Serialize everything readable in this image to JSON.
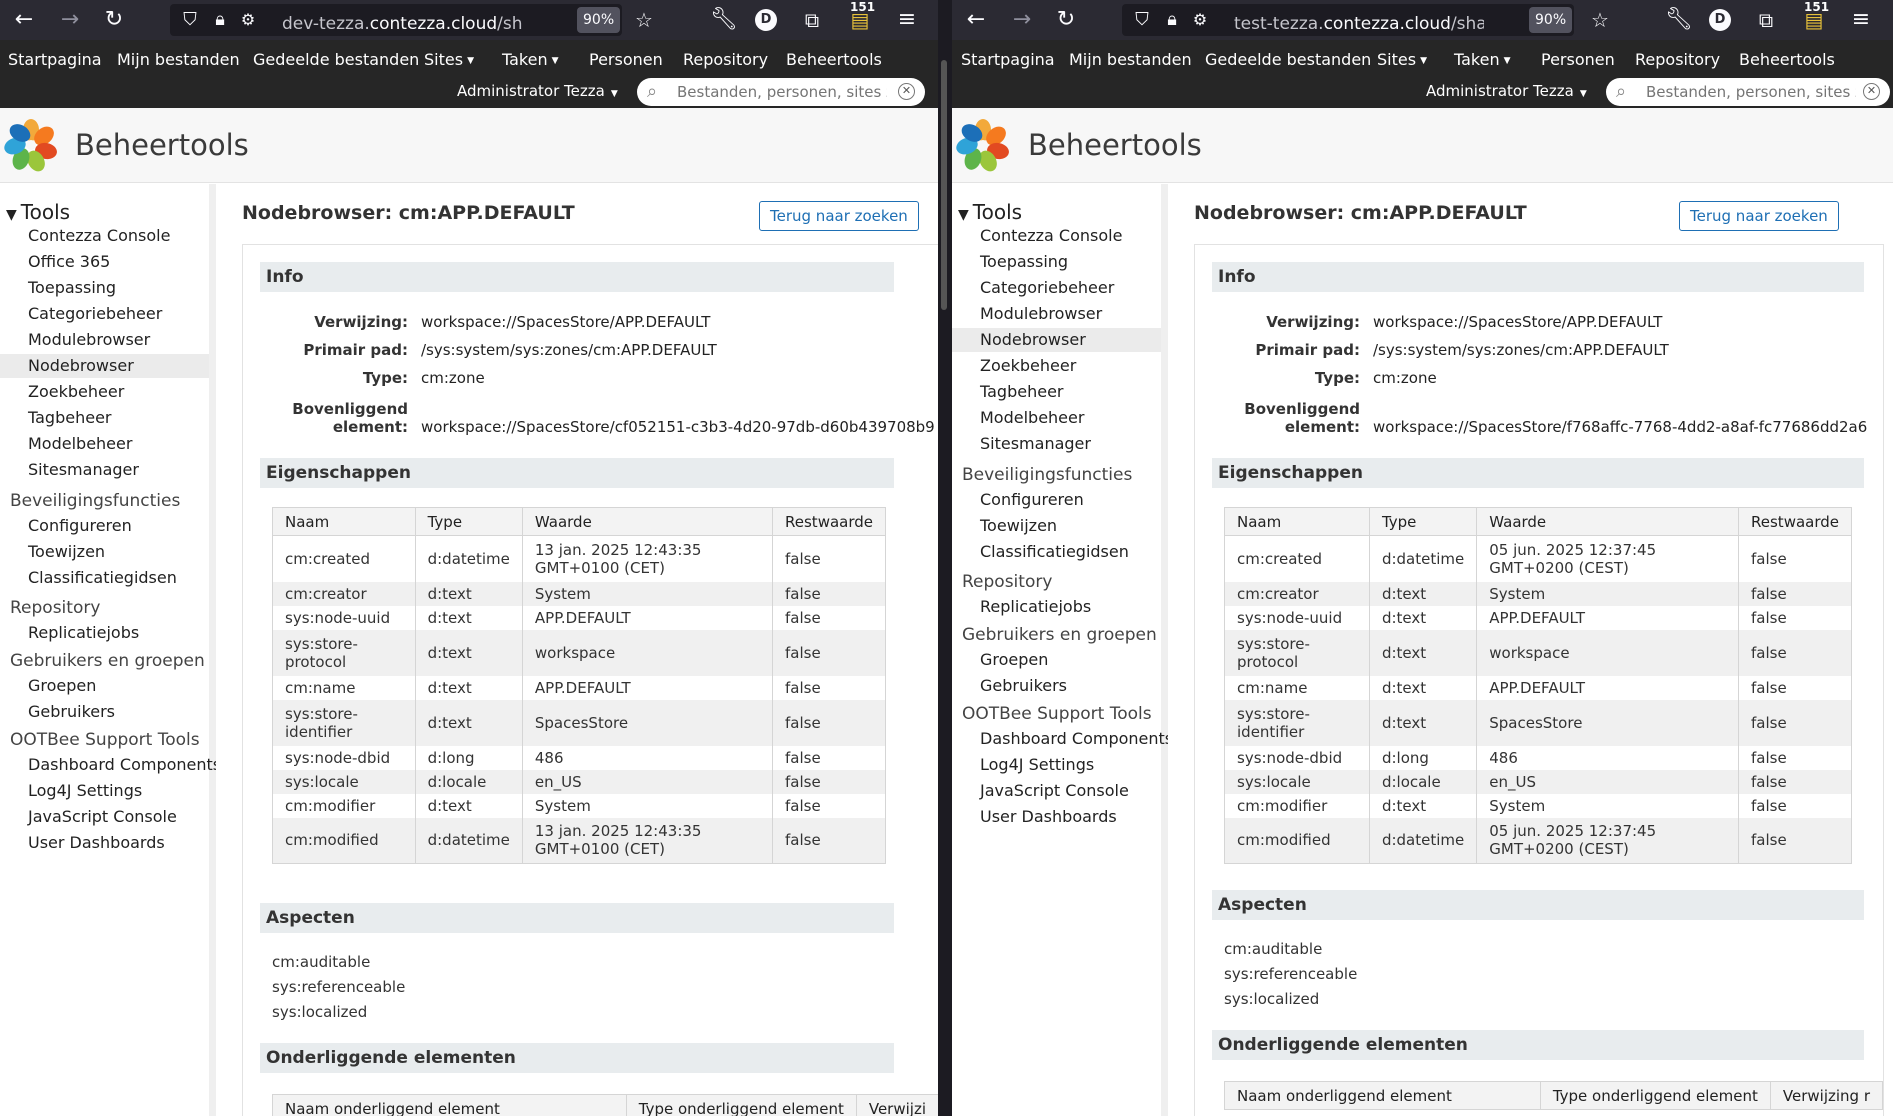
{
  "left": {
    "browser": {
      "url_prefix": "dev-tezza.",
      "url_domain": "contezza.cloud",
      "url_suffix": "/share/page",
      "zoom": "90%",
      "badge": "151",
      "profile": "D"
    },
    "nav": {
      "items": [
        "Startpagina",
        "Mijn bestanden",
        "Gedeelde bestanden",
        "Sites",
        "Taken",
        "Personen",
        "Repository",
        "Beheertools"
      ],
      "user": "Administrator Tezza",
      "search_placeholder": "Bestanden, personen, sites zo"
    },
    "page_title": "Beheertools",
    "sidebar": {
      "tools_heading": "Tools",
      "tools_items": [
        "Contezza Console",
        "Office 365",
        "Toepassing",
        "Categoriebeheer",
        "Modulebrowser",
        "Nodebrowser",
        "Zoekbeheer",
        "Tagbeheer",
        "Modelbeheer",
        "Sitesmanager"
      ],
      "groups": [
        {
          "name": "Beveiligingsfuncties",
          "items": [
            "Configureren",
            "Toewijzen",
            "Classificatiegidsen"
          ]
        },
        {
          "name": "Repository",
          "items": [
            "Replicatiejobs"
          ]
        },
        {
          "name": "Gebruikers en groepen",
          "items": [
            "Groepen",
            "Gebruikers"
          ]
        },
        {
          "name": "OOTBee Support Tools",
          "items": [
            "Dashboard Components",
            "Log4J Settings",
            "JavaScript Console",
            "User Dashboards"
          ]
        }
      ]
    },
    "main": {
      "heading": "Nodebrowser: cm:APP.DEFAULT",
      "back_button": "Terug naar zoeken",
      "info_title": "Info",
      "info": {
        "ref_label": "Verwijzing:",
        "ref": "workspace://SpacesStore/APP.DEFAULT",
        "path_label": "Primair pad:",
        "path": "/sys:system/sys:zones/cm:APP.DEFAULT",
        "type_label": "Type:",
        "type": "cm:zone",
        "parent_label_1": "Bovenliggend",
        "parent_label_2": "element:",
        "parent": "workspace://SpacesStore/cf052151-c3b3-4d20-97db-d60b439708b9"
      },
      "props_title": "Eigenschappen",
      "props_headers": [
        "Naam",
        "Type",
        "Waarde",
        "Restwaarde"
      ],
      "props": [
        [
          "cm:created",
          "d:datetime",
          "13 jan. 2025 12:43:35 GMT+0100 (CET)",
          "false"
        ],
        [
          "cm:creator",
          "d:text",
          "System",
          "false"
        ],
        [
          "sys:node-uuid",
          "d:text",
          "APP.DEFAULT",
          "false"
        ],
        [
          "sys:store-protocol",
          "d:text",
          "workspace",
          "false"
        ],
        [
          "cm:name",
          "d:text",
          "APP.DEFAULT",
          "false"
        ],
        [
          "sys:store-identifier",
          "d:text",
          "SpacesStore",
          "false"
        ],
        [
          "sys:node-dbid",
          "d:long",
          "486",
          "false"
        ],
        [
          "sys:locale",
          "d:locale",
          "en_US",
          "false"
        ],
        [
          "cm:modifier",
          "d:text",
          "System",
          "false"
        ],
        [
          "cm:modified",
          "d:datetime",
          "13 jan. 2025 12:43:35 GMT+0100 (CET)",
          "false"
        ]
      ],
      "aspects_title": "Aspecten",
      "aspects": [
        "cm:auditable",
        "sys:referenceable",
        "sys:localized"
      ],
      "children_title": "Onderliggende elementen",
      "children_headers": [
        "Naam onderliggend element",
        "Type onderliggend element",
        "Verwijzi"
      ]
    }
  },
  "right": {
    "browser": {
      "url_prefix": "test-tezza.",
      "url_domain": "contezza.cloud",
      "url_suffix": "/share/page/",
      "zoom": "90%",
      "badge": "151",
      "profile": "D"
    },
    "nav": {
      "items": [
        "Startpagina",
        "Mijn bestanden",
        "Gedeelde bestanden",
        "Sites",
        "Taken",
        "Personen",
        "Repository",
        "Beheertools"
      ],
      "user": "Administrator Tezza",
      "search_placeholder": "Bestanden, personen, sites zo"
    },
    "page_title": "Beheertools",
    "sidebar": {
      "tools_heading": "Tools",
      "tools_items": [
        "Contezza Console",
        "Toepassing",
        "Categoriebeheer",
        "Modulebrowser",
        "Nodebrowser",
        "Zoekbeheer",
        "Tagbeheer",
        "Modelbeheer",
        "Sitesmanager"
      ],
      "groups": [
        {
          "name": "Beveiligingsfuncties",
          "items": [
            "Configureren",
            "Toewijzen",
            "Classificatiegidsen"
          ]
        },
        {
          "name": "Repository",
          "items": [
            "Replicatiejobs"
          ]
        },
        {
          "name": "Gebruikers en groepen",
          "items": [
            "Groepen",
            "Gebruikers"
          ]
        },
        {
          "name": "OOTBee Support Tools",
          "items": [
            "Dashboard Components",
            "Log4J Settings",
            "JavaScript Console",
            "User Dashboards"
          ]
        }
      ]
    },
    "main": {
      "heading": "Nodebrowser: cm:APP.DEFAULT",
      "back_button": "Terug naar zoeken",
      "info_title": "Info",
      "info": {
        "ref_label": "Verwijzing:",
        "ref": "workspace://SpacesStore/APP.DEFAULT",
        "path_label": "Primair pad:",
        "path": "/sys:system/sys:zones/cm:APP.DEFAULT",
        "type_label": "Type:",
        "type": "cm:zone",
        "parent_label_1": "Bovenliggend",
        "parent_label_2": "element:",
        "parent": "workspace://SpacesStore/f768affc-7768-4dd2-a8af-fc77686dd2a6"
      },
      "props_title": "Eigenschappen",
      "props_headers": [
        "Naam",
        "Type",
        "Waarde",
        "Restwaarde"
      ],
      "props": [
        [
          "cm:created",
          "d:datetime",
          "05 jun. 2025 12:37:45 GMT+0200 (CEST)",
          "false"
        ],
        [
          "cm:creator",
          "d:text",
          "System",
          "false"
        ],
        [
          "sys:node-uuid",
          "d:text",
          "APP.DEFAULT",
          "false"
        ],
        [
          "sys:store-protocol",
          "d:text",
          "workspace",
          "false"
        ],
        [
          "cm:name",
          "d:text",
          "APP.DEFAULT",
          "false"
        ],
        [
          "sys:store-identifier",
          "d:text",
          "SpacesStore",
          "false"
        ],
        [
          "sys:node-dbid",
          "d:long",
          "486",
          "false"
        ],
        [
          "sys:locale",
          "d:locale",
          "en_US",
          "false"
        ],
        [
          "cm:modifier",
          "d:text",
          "System",
          "false"
        ],
        [
          "cm:modified",
          "d:datetime",
          "05 jun. 2025 12:37:45 GMT+0200 (CEST)",
          "false"
        ]
      ],
      "aspects_title": "Aspecten",
      "aspects": [
        "cm:auditable",
        "sys:referenceable",
        "sys:localized"
      ],
      "children_title": "Onderliggende elementen",
      "children_headers": [
        "Naam onderliggend element",
        "Type onderliggend element",
        "Verwijzing r"
      ]
    }
  }
}
